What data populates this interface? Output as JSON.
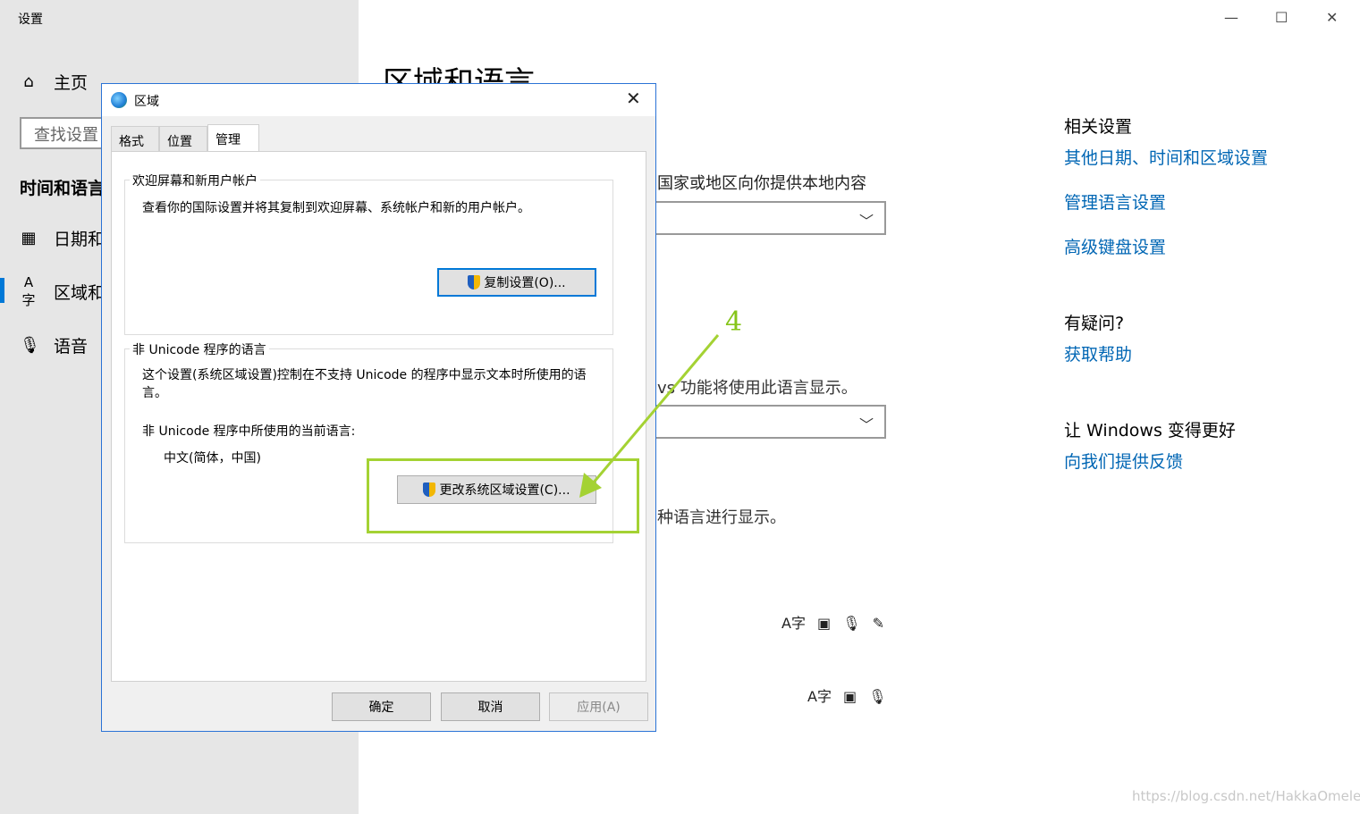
{
  "settings": {
    "window_title": "设置",
    "home_label": "主页",
    "search_placeholder": "查找设置",
    "section_title": "时间和语言",
    "nav": [
      {
        "label": "日期和",
        "icon": "calendar-clock-icon"
      },
      {
        "label": "区域和",
        "icon": "language-icon"
      },
      {
        "label": "语音",
        "icon": "microphone-icon"
      }
    ],
    "window_controls": {
      "minimize": "—",
      "maximize": "☐",
      "close": "✕"
    }
  },
  "main": {
    "title": "区域和语言",
    "country_desc": "国家或地区向你提供本地内容",
    "windows_lang_desc": "vs 功能将使用此语言显示。",
    "preferred_lang_desc": "种语言进行显示。"
  },
  "related": {
    "heading": "相关设置",
    "links": [
      "其他日期、时间和区域设置",
      "管理语言设置",
      "高级键盘设置"
    ],
    "help_heading": "有疑问?",
    "help_link": "获取帮助",
    "feedback_heading": "让 Windows 变得更好",
    "feedback_link": "向我们提供反馈"
  },
  "dialog": {
    "title": "区域",
    "tabs": [
      "格式",
      "位置",
      "管理"
    ],
    "active_tab": "管理",
    "welcome_group": {
      "label": "欢迎屏幕和新用户帐户",
      "desc": "查看你的国际设置并将其复制到欢迎屏幕、系统帐户和新的用户帐户。",
      "button": "复制设置(O)..."
    },
    "unicode_group": {
      "label": "非 Unicode 程序的语言",
      "desc": "这个设置(系统区域设置)控制在不支持 Unicode 的程序中显示文本时所使用的语言。",
      "current_label": "非 Unicode 程序中所使用的当前语言:",
      "current_value": "中文(简体，中国)",
      "button": "更改系统区域设置(C)..."
    },
    "buttons": {
      "ok": "确定",
      "cancel": "取消",
      "apply": "应用(A)"
    }
  },
  "annotation": {
    "step": "4",
    "color": "#a4d233"
  },
  "watermark": "https://blog.csdn.net/HakkaOmelet",
  "colors": {
    "accent": "#0078d7",
    "link": "#0066b4",
    "sidebar": "#e6e6e6"
  }
}
